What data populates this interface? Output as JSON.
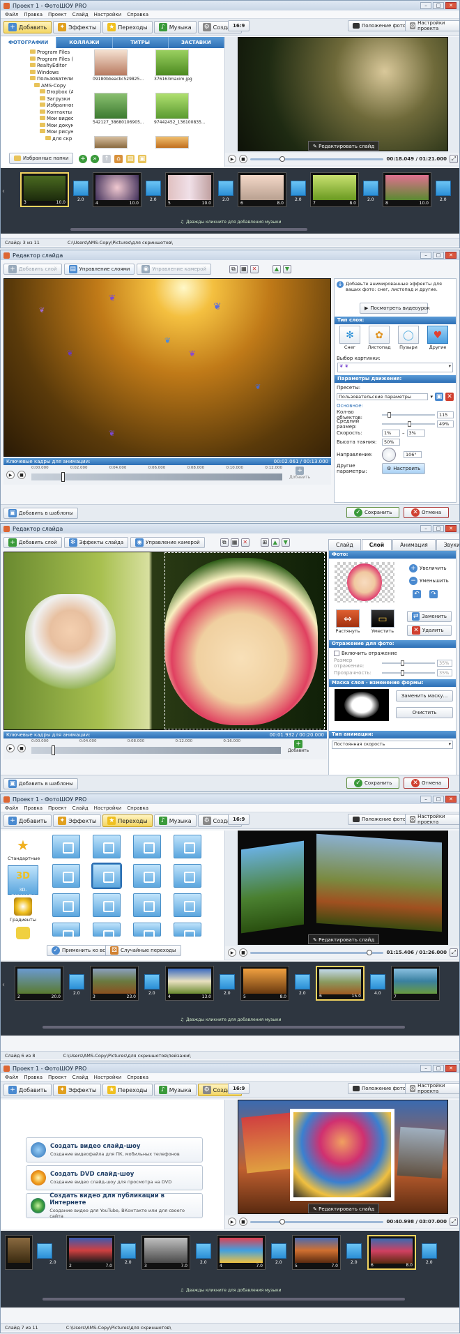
{
  "win1": {
    "title": "Проект 1 - ФотоШОУ PRO",
    "menu": [
      "Файл",
      "Правка",
      "Проект",
      "Слайд",
      "Настройки",
      "Справка"
    ],
    "tabs": [
      "Добавить",
      "Эффекты",
      "Переходы",
      "Музыка",
      "Создать"
    ],
    "ratio": "16:9",
    "photo_position": "Положение фото",
    "project_settings": "Настройки проекта",
    "subtabs": [
      "ФОТОГРАФИИ",
      "КОЛЛАЖИ",
      "ТИТРЫ",
      "ЗАСТАВКИ"
    ],
    "tree": [
      "Program Files",
      "Program Files (x8",
      "RealtyEditor",
      "Windows",
      "Пользователи",
      "AMS-Copy",
      "Dropbox (А",
      "Загрузки",
      "Избранное",
      "Контакты",
      "Мои видео",
      "Мои докум",
      "Мои рисун",
      "для скр"
    ],
    "thumbs": [
      "09180bbeacbc529825...",
      "376163maxim.jpg",
      "542127_38680106905...",
      "97442452_136100835..."
    ],
    "fav_folders": "Избранные папки",
    "edit_slide": "Редактировать слайд",
    "time": "00:18.049 / 01:21.000",
    "slides": [
      {
        "num": "3",
        "dur": "10.0",
        "trans": "2.0"
      },
      {
        "num": "4",
        "dur": "10.0",
        "trans": "2.0"
      },
      {
        "num": "5",
        "dur": "10.0",
        "trans": "2.0"
      },
      {
        "num": "6",
        "dur": "8.0",
        "trans": "2.0"
      },
      {
        "num": "7",
        "dur": "8.0",
        "trans": "2.0"
      },
      {
        "num": "8",
        "dur": "10.0",
        "trans": "2.0"
      }
    ],
    "music_hint": "Дважды кликните для добавления музыки",
    "status_slide": "Слайд: 3 из 11",
    "status_path": "C:\\Users\\AMS-Copy\\Pictures\\для скриншотов\\"
  },
  "win2": {
    "title": "Редактор слайда",
    "add_layer": "Добавить слой",
    "manage_layers": "Управление слоями",
    "manage_camera": "Управление камерой",
    "hint": "Добавьте анимированные эффекты для ваших фото: снег, листопад и другие.",
    "watch_video": "Посмотреть видеоурок",
    "layer_type": "Тип слоя:",
    "layer_types": [
      "Снег",
      "Листопад",
      "Пузыри",
      "Другие"
    ],
    "pic_choice": "Выбор картинки:",
    "motion_params": "Параметры движения:",
    "presets": "Пресеты:",
    "preset_value": "Пользовательские параметры",
    "basic": "Основное:",
    "count_label": "Кол-во объектов:",
    "count_value": "115",
    "size_label": "Средний размер:",
    "size_value": "49%",
    "speed_label": "Скорость:",
    "speed_from": "1%",
    "speed_to": "3%",
    "fade_label": "Высота таяния:",
    "fade_value": "50%",
    "dir_label": "Направление:",
    "dir_value": "106°",
    "other_label": "Другие параметры:",
    "setup": "Настроить",
    "keyframes": "Ключевые кадры для анимации:",
    "kf_time": "00:02.061 / 00:13.000",
    "ticks": [
      "0:00.000",
      "0:02.000",
      "0:04.000",
      "0:06.000",
      "0:08.000",
      "0:10.000",
      "0:12.000"
    ],
    "add": "Добавить",
    "add_template": "Добавить в шаблоны",
    "save": "Сохранить",
    "cancel": "Отмена"
  },
  "win3": {
    "title": "Редактор слайда",
    "add_layer": "Добавить слой",
    "slide_effects": "Эффекты слайда",
    "manage_camera": "Управление камерой",
    "tabs": [
      "Слайд",
      "Слой",
      "Анимация",
      "Звуки"
    ],
    "photo_label": "Фото:",
    "zoom_in": "Увеличить",
    "zoom_out": "Уменьшить",
    "stretch": "Растянуть",
    "fit": "Уместить",
    "replace": "Заменить",
    "delete": "Удалить",
    "reflection": "Отражение для фото:",
    "enable_reflection": "Включить отражение",
    "refl_size": "Размер отражения:",
    "refl_size_v": "35%",
    "transparency": "Прозрачность:",
    "transparency_v": "35%",
    "mask_head": "Маска слоя - изменение формы:",
    "replace_mask": "Заменить маску...",
    "clear": "Очистить",
    "anim_type": "Тип анимации:",
    "anim_value": "Постоянная скорость",
    "keyframes": "Ключевые кадры для анимации:",
    "kf_time": "00:01.932 / 00:20.000",
    "ticks": [
      "0:00.000",
      "0:04.000",
      "0:08.000",
      "0:12.000",
      "0:16.000"
    ],
    "add": "Добавить",
    "add_template": "Добавить в шаблоны",
    "save": "Сохранить",
    "cancel": "Отмена"
  },
  "win4": {
    "title": "Проект 1 - ФотоШОУ PRO",
    "menu": [
      "Файл",
      "Правка",
      "Проект",
      "Слайд",
      "Настройки",
      "Справка"
    ],
    "tabs": [
      "Добавить",
      "Эффекты",
      "Переходы",
      "Музыка",
      "Создать"
    ],
    "ratio": "16:9",
    "photo_position": "Положение фото",
    "project_settings": "Настройки проекта",
    "cats": [
      "Стандартные",
      "3D-переходы",
      "Градиенты"
    ],
    "apply_all": "Применить ко всем",
    "random": "Случайные переходы",
    "edit_slide": "Редактировать слайд",
    "time": "01:15.406 / 01:26.000",
    "slides": [
      {
        "num": "2",
        "dur": "20.0",
        "trans": "2.0"
      },
      {
        "num": "3",
        "dur": "23.0",
        "trans": "2.0"
      },
      {
        "num": "4",
        "dur": "13.0",
        "trans": "2.0"
      },
      {
        "num": "5",
        "dur": "8.0",
        "trans": "2.0"
      },
      {
        "num": "6",
        "dur": "15.0",
        "trans": "4.0"
      },
      {
        "num": "7",
        "dur": "",
        "trans": ""
      }
    ],
    "music_hint": "Дважды кликните для добавления музыки",
    "status_slide": "Слайд 6 из 8",
    "status_path": "C:\\Users\\AMS-Copy\\Pictures\\для скриншотов\\пейзажи\\"
  },
  "win5": {
    "title": "Проект 1 - ФотоШОУ PRO",
    "menu": [
      "Файл",
      "Правка",
      "Проект",
      "Слайд",
      "Настройки",
      "Справка"
    ],
    "tabs": [
      "Добавить",
      "Эффекты",
      "Переходы",
      "Музыка",
      "Создать"
    ],
    "ratio": "16:9",
    "photo_position": "Положение фото",
    "project_settings": "Настройки проекта",
    "options": [
      {
        "title": "Создать видео слайд-шоу",
        "desc": "Создание видеофайла для ПК, мобильных телефонов"
      },
      {
        "title": "Создать DVD слайд-шоу",
        "desc": "Создание видео слайд-шоу для просмотра на DVD"
      },
      {
        "title": "Создать видео для публикации в Интернете",
        "desc": "Создание видео для YouTube, ВКонтакте или для своего сайта"
      }
    ],
    "edit_slide": "Редактировать слайд",
    "time": "00:40.998 / 03:07.000",
    "slides": [
      {
        "num": "",
        "dur": "2.0",
        "trans": "2.0"
      },
      {
        "num": "2",
        "dur": "7.0",
        "trans": "2.0"
      },
      {
        "num": "3",
        "dur": "7.0",
        "trans": "2.0"
      },
      {
        "num": "4",
        "dur": "7.0",
        "trans": "2.0"
      },
      {
        "num": "5",
        "dur": "7.0",
        "trans": "2.0"
      },
      {
        "num": "6",
        "dur": "8.0",
        "trans": "2.0"
      }
    ],
    "music_hint": "Дважды кликните для добавления музыки",
    "status_slide": "Слайд 7 из 11",
    "status_path": "C:\\Users\\AMS-Copy\\Pictures\\для скриншотов\\"
  }
}
